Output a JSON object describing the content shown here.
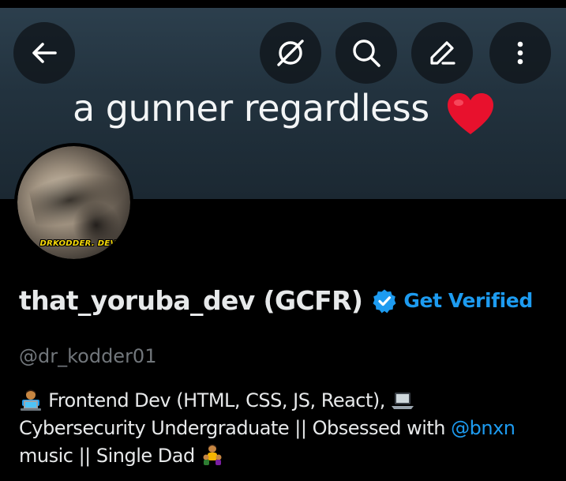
{
  "banner": {
    "text": "a gunner regardless",
    "emoji": "heart"
  },
  "actions": {
    "back": "arrow-left-icon",
    "grok": "grok-icon",
    "search": "search-icon",
    "edit": "edit-icon",
    "more": "more-vertical-icon"
  },
  "avatar": {
    "watermark": "DRKODDER. DEV"
  },
  "profile": {
    "display_name": "that_yoruba_dev (GCFR)",
    "get_verified_label": "Get Verified",
    "handle": "@dr_kodder01",
    "bio": {
      "line1_text": "Frontend Dev (HTML, CSS, JS, React),",
      "line2_text": "Cybersecurity Undergraduate || Obsessed with ",
      "mention": "@bnxn",
      "line3_text": "music || Single Dad "
    }
  },
  "colors": {
    "accent": "#1d9bf0",
    "background": "#000000",
    "banner": "#22323e",
    "muted_text": "#71767b"
  }
}
